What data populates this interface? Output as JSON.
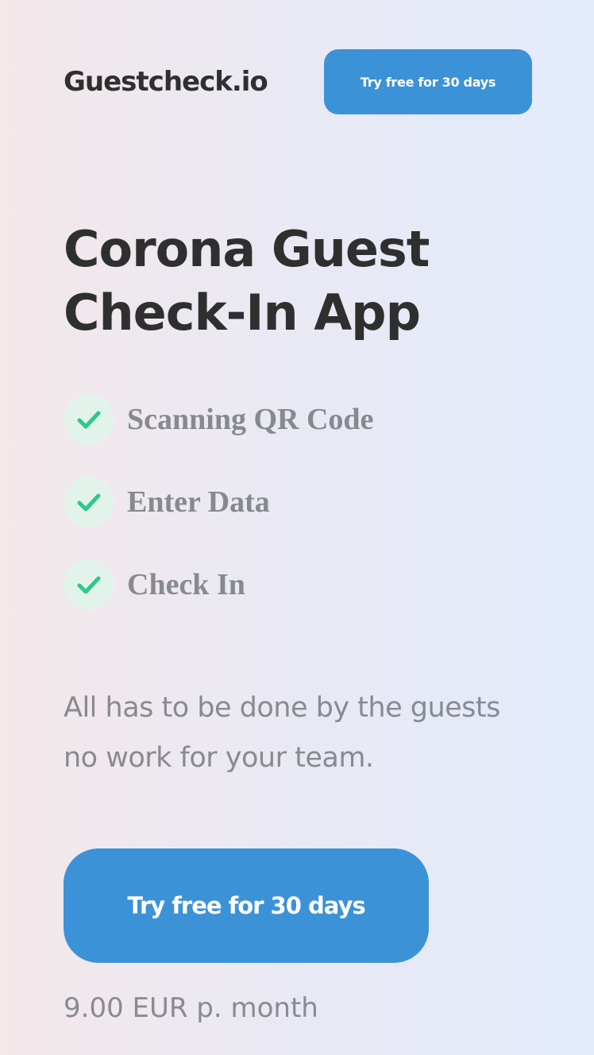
{
  "header": {
    "logo": "Guestcheck.io",
    "cta_label": "Try free for 30 days"
  },
  "hero": {
    "title_line_1": "Corona Guest",
    "title_line_2": "Check-In App"
  },
  "features": [
    {
      "label": "Scanning QR Code",
      "icon": "check-icon"
    },
    {
      "label": "Enter Data",
      "icon": "check-icon"
    },
    {
      "label": "Check In",
      "icon": "check-icon"
    }
  ],
  "description": {
    "line_1": "All has to be done by the guests",
    "line_2": "no work for your team."
  },
  "cta": {
    "label": "Try free for 30 days"
  },
  "pricing": {
    "text": "9.00 EUR p. month"
  },
  "colors": {
    "accent": "#3c92d6",
    "check": "#2fc78c",
    "check_bg": "#e2f3ec",
    "heading": "#2f2f2f",
    "muted": "#878b90"
  }
}
